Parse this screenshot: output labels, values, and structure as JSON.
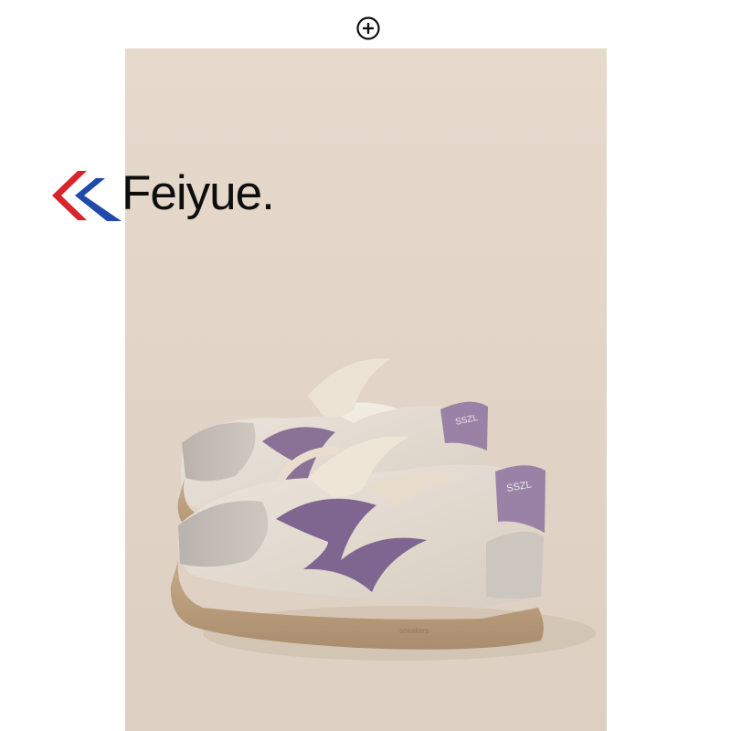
{
  "top_icon": {
    "name": "plus-circle-icon"
  },
  "brand": {
    "name": "Feiyue.",
    "logo_colors": {
      "red": "#d8252c",
      "blue": "#1f4aa8"
    }
  },
  "photo": {
    "background_color": "#e3d6c9",
    "product": "sneakers",
    "accent_color": "#8a7296"
  }
}
